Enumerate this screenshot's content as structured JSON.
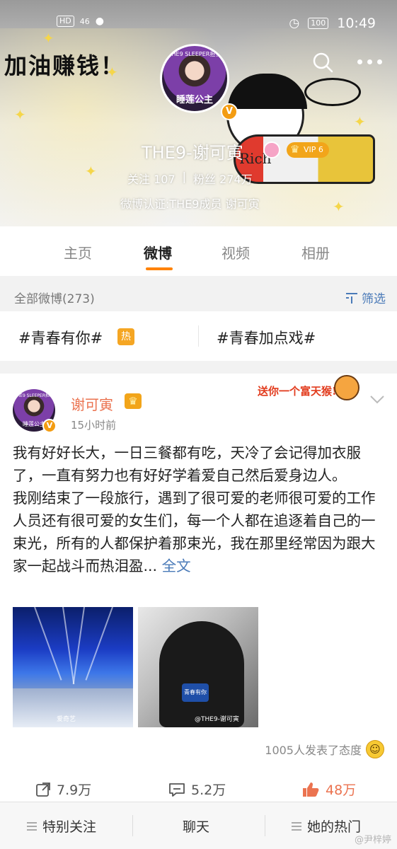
{
  "status_bar": {
    "network_badge": "HD",
    "signal": "46",
    "battery": "100",
    "time": "10:49"
  },
  "header": {
    "slogan": "加油赚钱！",
    "avatar_ring_text": "THE9 SLEEPER担当",
    "avatar_label": "睡莲公主",
    "verified_mark": "V",
    "rocket_text": "Rich",
    "name": "THE9-谢可寅",
    "vip_label": "VIP 6",
    "following_label": "关注",
    "following_count": "107",
    "followers_label": "粉丝",
    "followers_count": "274万",
    "verification": "微博认证:THE9成员 谢可寅"
  },
  "tabs": [
    {
      "label": "主页"
    },
    {
      "label": "微博"
    },
    {
      "label": "视频"
    },
    {
      "label": "相册"
    }
  ],
  "filter_bar": {
    "count_label": "全部微博(273)",
    "filter_label": "筛选"
  },
  "topics": [
    {
      "label": "#青春有你#",
      "badge": "热"
    },
    {
      "label": "#青春加点戏#"
    }
  ],
  "post": {
    "avatar_ring_text": "THE9 SLEEPER担当",
    "avatar_label": "睡莲公主",
    "verified_mark": "V",
    "author": "谢可寅",
    "time": "15小时前",
    "sticker_text": "送你一个富天猴!",
    "paragraph1": "我有好好长大，一日三餐都有吃，天冷了会记得加衣服了，一直有努力也有好好学着爱自己然后爱身边人。",
    "paragraph2": "我刚结束了一段旅行，遇到了很可爱的老师很可爱的工作人员还有很可爱的女生们，每一个人都在追逐着自己的一束光，所有的人都保护着那束光，我在那里经常因为跟大家一起战斗而热泪盈...",
    "more_label": "全文",
    "image1_caption": "爱奇艺",
    "image2_caption": "@THE9-谢可寅",
    "image2_mic_label": "青春有你",
    "attitude_text": "1005人发表了态度",
    "repost_count": "7.9万",
    "comment_count": "5.2万",
    "like_count": "48万"
  },
  "bottom_bar": [
    {
      "label": "特别关注"
    },
    {
      "label": "聊天"
    },
    {
      "label": "她的热门"
    }
  ],
  "watermark": "@尹梓婷",
  "colors": {
    "accent_orange": "#ff8200",
    "link_blue": "#4a7ab8",
    "author_orange": "#eb7350",
    "vip_gold": "#f2a51a"
  }
}
